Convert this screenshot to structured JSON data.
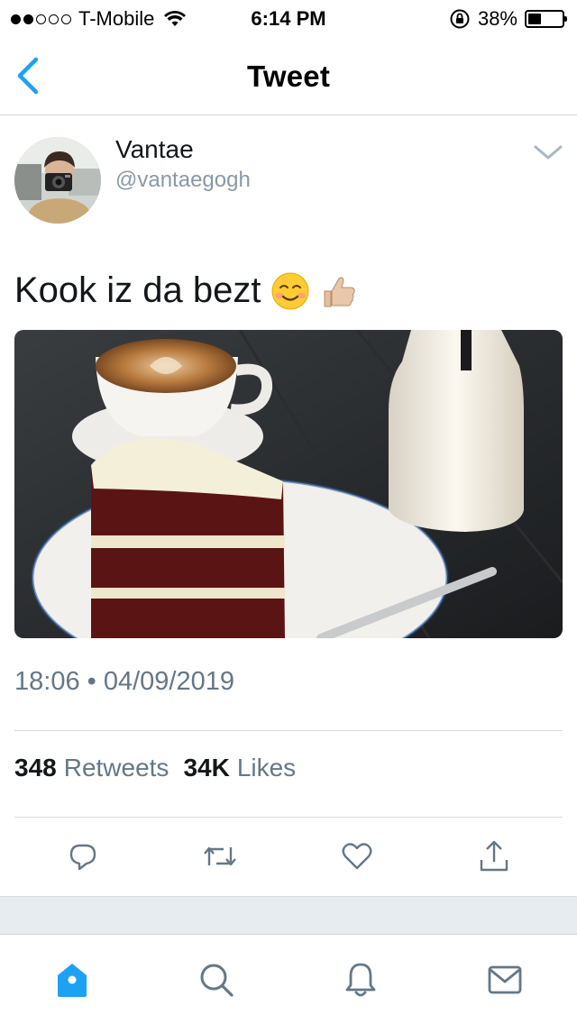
{
  "status_bar": {
    "carrier": "T-Mobile",
    "signal_dots": [
      true,
      true,
      false,
      false,
      false
    ],
    "time": "6:14 PM",
    "battery_percent": "38%",
    "battery_level": 0.38
  },
  "nav": {
    "title": "Tweet",
    "back_icon": "chevron-left-icon"
  },
  "tweet": {
    "display_name": "Vantae",
    "handle": "@vantaegogh",
    "text": "Kook iz da bezt",
    "emojis": [
      "smiling-face-icon",
      "thumbs-up-icon"
    ],
    "timestamp": "18:06 • 04/09/2019",
    "retweet_count": "348",
    "retweet_label": "Retweets",
    "like_count": "34K",
    "like_label": "Likes"
  },
  "actions": [
    {
      "name": "reply-icon"
    },
    {
      "name": "retweet-icon"
    },
    {
      "name": "like-icon"
    },
    {
      "name": "share-icon"
    }
  ],
  "tabs": [
    {
      "name": "home-icon",
      "active": true
    },
    {
      "name": "search-icon",
      "active": false
    },
    {
      "name": "notifications-icon",
      "active": false
    },
    {
      "name": "messages-icon",
      "active": false
    }
  ],
  "colors": {
    "accent": "#1da1f2",
    "secondary_text": "#657786",
    "icon_gray": "#657786"
  }
}
